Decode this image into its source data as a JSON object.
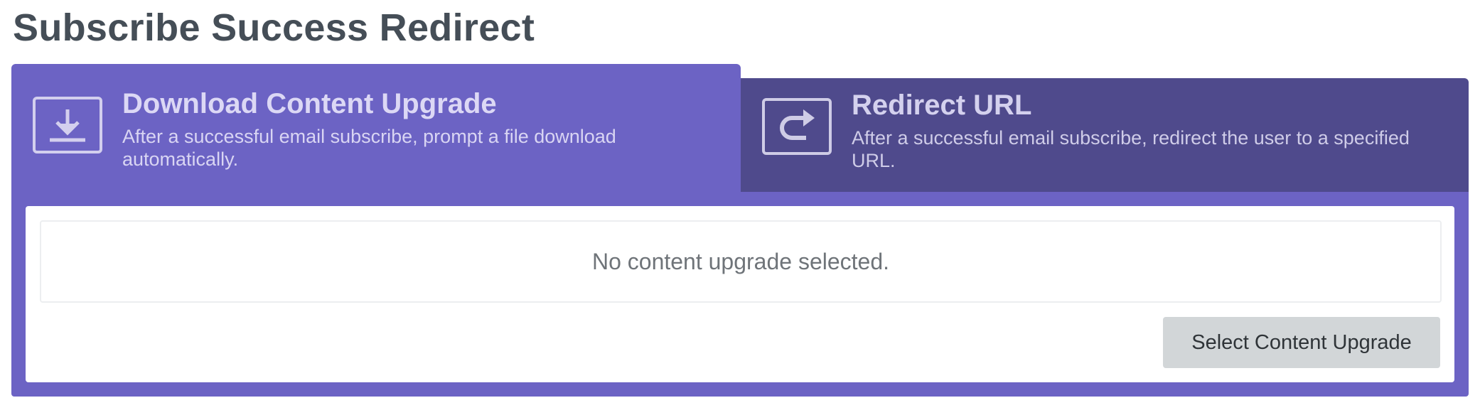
{
  "page": {
    "title": "Subscribe Success Redirect"
  },
  "tabs": [
    {
      "title": "Download Content Upgrade",
      "description": "After a successful email subscribe, prompt a file download automatically.",
      "icon": "download-icon",
      "active": true
    },
    {
      "title": "Redirect URL",
      "description": "After a successful email subscribe, redirect the user to a specified URL.",
      "icon": "redirect-icon",
      "active": false
    }
  ],
  "content": {
    "empty_message": "No content upgrade selected.",
    "select_button_label": "Select Content Upgrade"
  },
  "colors": {
    "accent": "#6c63c4",
    "inactive_tab": "#4f4a8c",
    "button_bg": "#d2d6d8",
    "title_text": "#454e57"
  }
}
